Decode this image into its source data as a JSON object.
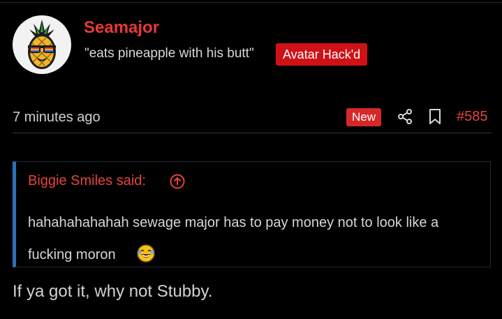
{
  "post": {
    "username": "Seamajor",
    "user_title": "\"eats pineapple with his butt\"",
    "user_banner": "Avatar Hack'd",
    "timestamp": "7 minutes ago",
    "new_badge": "New",
    "post_number": "#585",
    "quote": {
      "author_line": "Biggie Smiles said:",
      "text": "hahahahahahah sewage major has to pay money not to look like a fucking moron"
    },
    "message": "If ya got it, why not Stubby."
  },
  "colors": {
    "accent": "#e53a35",
    "banner_bg": "#d01217",
    "quote_border": "#2d70b8",
    "background": "#000000"
  },
  "icons": {
    "share": "share-icon",
    "bookmark": "bookmark-icon",
    "quote_jump": "arrow-up-circle-icon",
    "emoji": "laughing-emoji-icon"
  }
}
